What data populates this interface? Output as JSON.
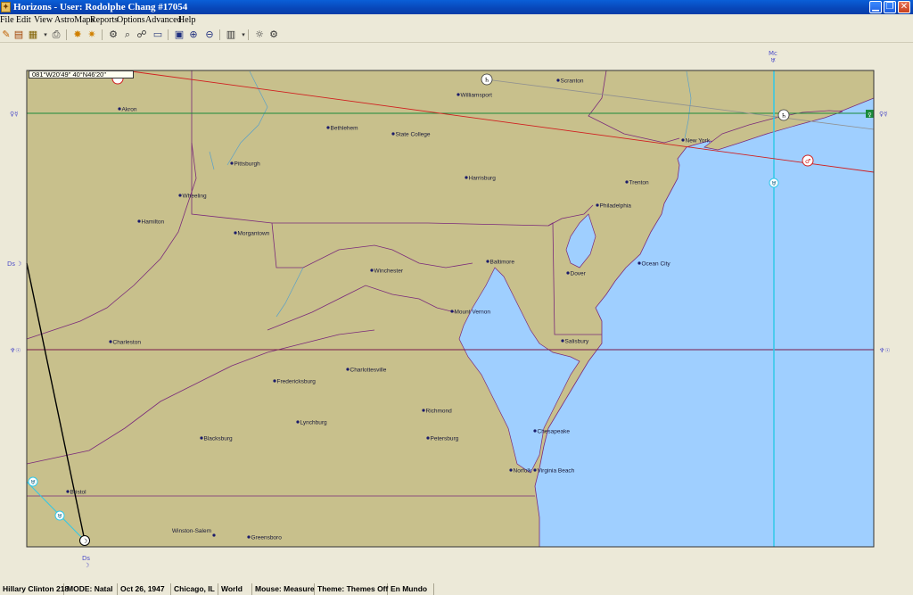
{
  "window": {
    "title": "Horizons - User: Rodolphe Chang #17054",
    "app_icon": "horizons-app-icon",
    "buttons": [
      "minimize-icon",
      "maximize-icon",
      "close-icon"
    ]
  },
  "menu": [
    "File",
    "Edit",
    "View",
    "AstroMaps",
    "Reports",
    "Options",
    "Advanced",
    "Help"
  ],
  "toolbar": {
    "icons": [
      "pencil-icon",
      "chart-icon",
      "edit-chart-icon",
      "dropdown-arrow-icon",
      "print-icon",
      "astro-map-icon",
      "relocate-icon",
      "settings-icon",
      "find-icon",
      "planets-icon",
      "monitor-icon",
      "view-icon",
      "zoom-in-icon",
      "zoom-out-icon",
      "grid-icon",
      "dropdown-arrow-icon",
      "sun-icon",
      "gear-icon"
    ]
  },
  "map": {
    "coordinates": "081°W20'49\"   40°N46'20\"",
    "land_color": "#c8c08c",
    "water_color": "#9fcfff",
    "cities": [
      {
        "name": "Akron"
      },
      {
        "name": "Williamsport"
      },
      {
        "name": "Scranton"
      },
      {
        "name": "Bethlehem"
      },
      {
        "name": "State College"
      },
      {
        "name": "New York"
      },
      {
        "name": "Pittsburgh"
      },
      {
        "name": "Harrisburg"
      },
      {
        "name": "Trenton"
      },
      {
        "name": "Wheeling"
      },
      {
        "name": "Philadelphia"
      },
      {
        "name": "Hamilton"
      },
      {
        "name": "Morgantown"
      },
      {
        "name": "Baltimore"
      },
      {
        "name": "Ocean City"
      },
      {
        "name": "Winchester"
      },
      {
        "name": "Dover"
      },
      {
        "name": "Mount Vernon"
      },
      {
        "name": "Charleston"
      },
      {
        "name": "Salisbury"
      },
      {
        "name": "Charlottesville"
      },
      {
        "name": "Fredericksburg"
      },
      {
        "name": "Richmond"
      },
      {
        "name": "Lynchburg"
      },
      {
        "name": "Blacksburg"
      },
      {
        "name": "Petersburg"
      },
      {
        "name": "Chesapeake"
      },
      {
        "name": "Norfolk"
      },
      {
        "name": "Virginia Beach"
      },
      {
        "name": "Bristol"
      },
      {
        "name": "Winston-Salem"
      },
      {
        "name": "Greensboro"
      }
    ],
    "lines": {
      "mc_label": "Mc",
      "ds_label": "Ds",
      "venus_mercury": "♀☿",
      "neptune_sun": "♆☉"
    }
  },
  "status": {
    "chart": "Hillary Clinton 218",
    "mode": "MODE: Natal",
    "date": "Oct 26, 1947",
    "location": "Chicago, IL",
    "scope": "World",
    "mouse": "Mouse: Measure",
    "theme": "Theme: Themes Off",
    "mundo": "En Mundo"
  }
}
